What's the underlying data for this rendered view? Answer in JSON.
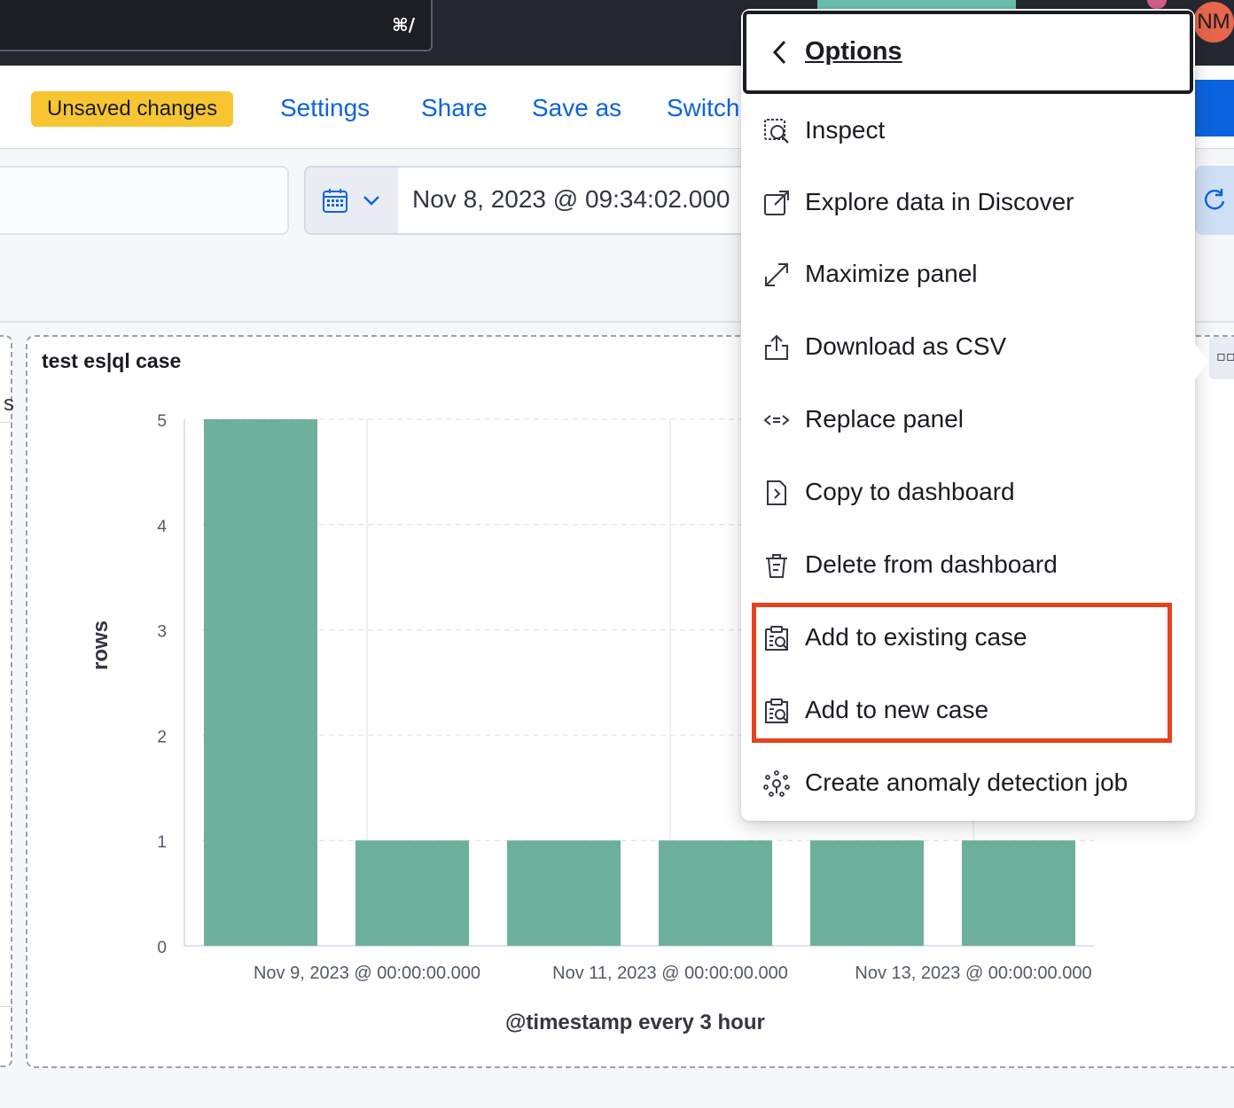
{
  "header": {
    "shortcut": "⌘/",
    "avatar_initials": "NM"
  },
  "toolbar": {
    "unsaved_badge": "Unsaved changes",
    "links": [
      "Settings",
      "Share",
      "Save as",
      "Switch"
    ]
  },
  "time_picker": {
    "start": "Nov 8, 2023 @ 09:34:02.000"
  },
  "panel": {
    "title": "test es|ql case"
  },
  "chart_data": {
    "type": "bar",
    "ylabel": "rows",
    "xlabel": "@timestamp every 3 hour",
    "ylim": [
      0,
      5
    ],
    "yticks": [
      "0",
      "1",
      "2",
      "3",
      "4",
      "5"
    ],
    "xtick_labels": [
      "Nov 9, 2023 @ 00:00:00.000",
      "Nov 11, 2023 @ 00:00:00.000",
      "Nov 13, 2023 @ 00:00:00.000"
    ],
    "values": [
      5,
      1,
      1,
      1,
      1,
      1
    ],
    "bar_color": "#6db09b",
    "grid": true
  },
  "menu": {
    "title": "Options",
    "items": [
      {
        "label": "Inspect",
        "icon": "inspect-icon"
      },
      {
        "label": "Explore data in Discover",
        "icon": "external-link-icon"
      },
      {
        "label": "Maximize panel",
        "icon": "expand-icon"
      },
      {
        "label": "Download as CSV",
        "icon": "export-icon"
      },
      {
        "label": "Replace panel",
        "icon": "replace-icon"
      },
      {
        "label": "Copy to dashboard",
        "icon": "copy-dashboard-icon"
      },
      {
        "label": "Delete from dashboard",
        "icon": "trash-icon"
      },
      {
        "label": "Add to existing case",
        "icon": "case-icon"
      },
      {
        "label": "Add to new case",
        "icon": "case-icon"
      },
      {
        "label": "Create anomaly detection job",
        "icon": "ml-job-icon"
      }
    ]
  },
  "colors": {
    "accent": "#0b64dd",
    "highlight": "#e5421d",
    "badge": "#f6c531"
  }
}
